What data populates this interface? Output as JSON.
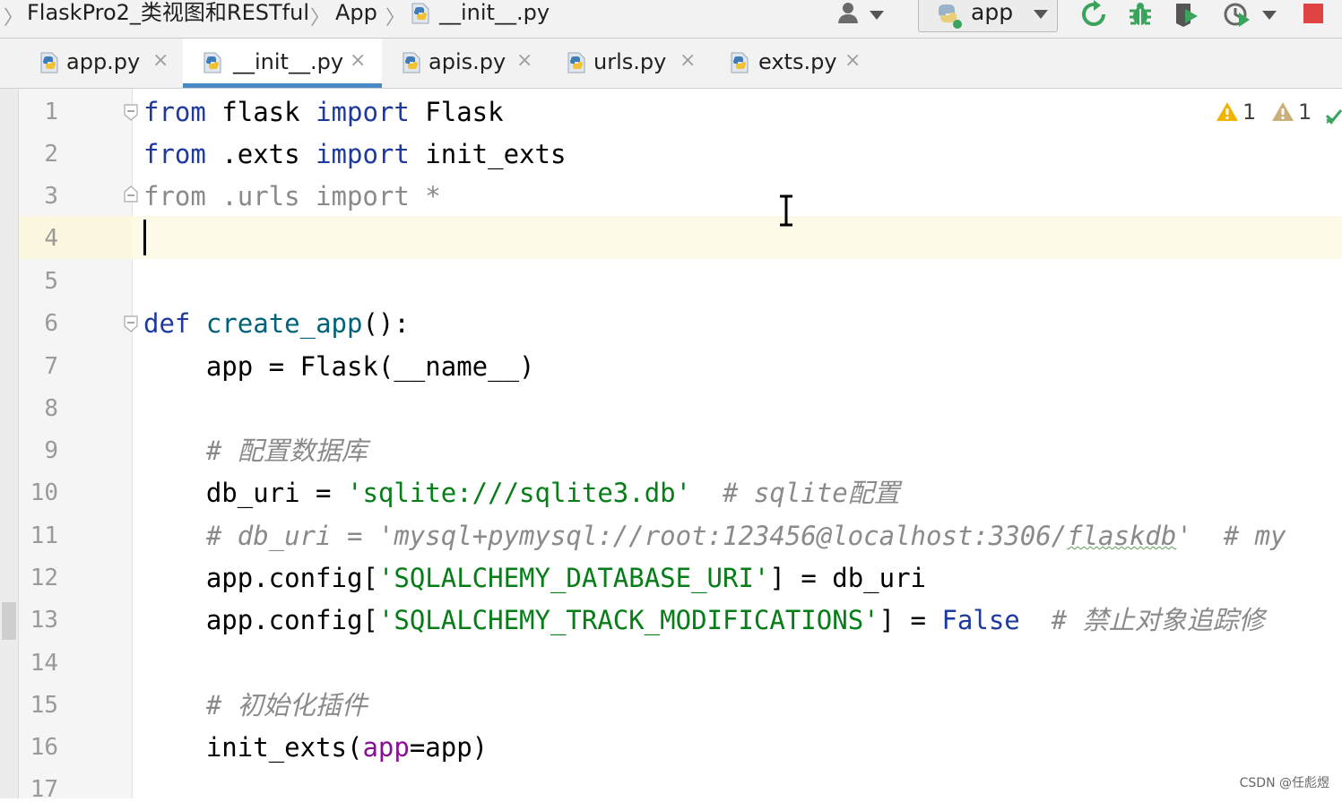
{
  "breadcrumbs": [
    "FlaskPro2_类视图和RESTful",
    "App",
    "__init__.py"
  ],
  "run_config": {
    "label": "app"
  },
  "tabs": [
    {
      "label": "app.py",
      "active": false
    },
    {
      "label": "__init__.py",
      "active": true
    },
    {
      "label": "apis.py",
      "active": false
    },
    {
      "label": "urls.py",
      "active": false
    },
    {
      "label": "exts.py",
      "active": false
    }
  ],
  "tab_close_glyph": "×",
  "inspections": {
    "warnings": "1",
    "weak_warnings": "1"
  },
  "line_numbers": [
    "1",
    "2",
    "3",
    "4",
    "5",
    "6",
    "7",
    "8",
    "9",
    "10",
    "11",
    "12",
    "13",
    "14",
    "15",
    "16",
    "17"
  ],
  "code": {
    "l1": {
      "kw1": "from",
      "mod": " flask ",
      "kw2": "import",
      "name": " Flask"
    },
    "l2": {
      "kw1": "from",
      "mod": " .exts ",
      "kw2": "import",
      "name": " init_exts"
    },
    "l3": {
      "text": "from .urls import *"
    },
    "l6": {
      "kw": "def",
      "sp": " ",
      "fn": "create_app",
      "rest": "():"
    },
    "l7": {
      "text": "    app = Flask(__name__)"
    },
    "l9": {
      "text": "    # 配置数据库"
    },
    "l10": {
      "pre": "    db_uri = ",
      "str": "'sqlite:///sqlite3.db'",
      "cmt": "  # sqlite配置"
    },
    "l11": {
      "pre": "    # db_uri = 'mysql+pymysql://root:123456@localhost:3306/",
      "typo": "flaskdb",
      "post": "'  # my"
    },
    "l12": {
      "pre": "    app.config[",
      "str": "'SQLALCHEMY_DATABASE_URI'",
      "post": "] = db_uri"
    },
    "l13": {
      "pre": "    app.config[",
      "str": "'SQLALCHEMY_TRACK_MODIFICATIONS'",
      "mid": "] = ",
      "const": "False",
      "cmt": "  # 禁止对象追踪修"
    },
    "l15": {
      "text": "    # 初始化插件"
    },
    "l16": {
      "pre": "    init_exts(",
      "param": "app",
      "post": "=app)"
    }
  },
  "watermark": "CSDN @任彪煜",
  "colors": {
    "keyword": "#1e3a9e",
    "string": "#067d17",
    "comment": "#8a8a8a",
    "tab_underline": "#4a88c7",
    "current_line": "#fdfae8",
    "stop": "#e04343",
    "run_green": "#3aa35c"
  }
}
